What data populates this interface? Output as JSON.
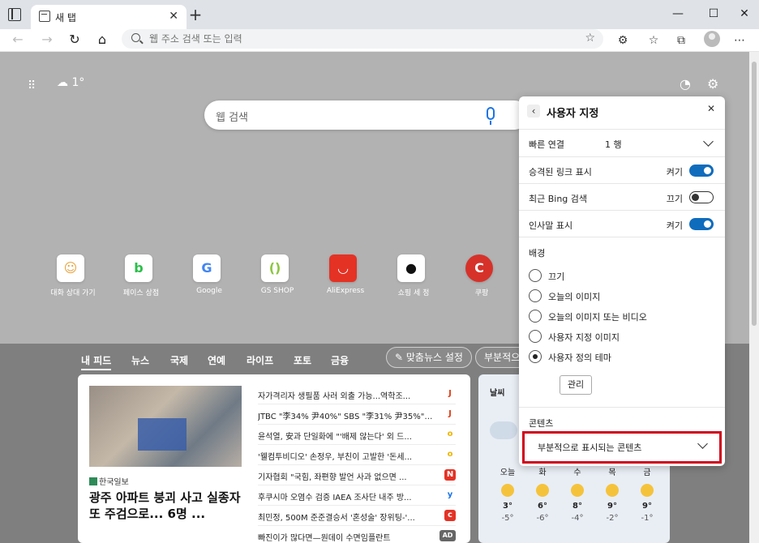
{
  "tab": {
    "title": "새 탭",
    "close": "✕"
  },
  "window": {
    "minimize": "—",
    "maximize": "☐",
    "close": "✕"
  },
  "address": {
    "placeholder": "웹 주소 검색 또는 입력"
  },
  "page": {
    "weather_top": "☁ 1°",
    "search_placeholder": "웹 검색",
    "quick_links": [
      {
        "icon": "person-icon",
        "glyph": "👤",
        "label": "대화 상대 가기",
        "color": "#e9a23b"
      },
      {
        "icon": "b-icon",
        "glyph": "b",
        "label": "페이스 상점",
        "color": "#2bbf4a"
      },
      {
        "icon": "google-icon",
        "glyph": "G",
        "label": "Google",
        "color": "#4285f4"
      },
      {
        "icon": "bracket-icon",
        "glyph": "()",
        "label": "GS SHOP",
        "color": "#8cc63f"
      },
      {
        "icon": "aliexpress-icon",
        "glyph": "◡",
        "label": "AliExpress",
        "color": "#e43225"
      },
      {
        "icon": "apple-icon",
        "glyph": "●",
        "label": "쇼핑 세 정",
        "color": "#111111"
      },
      {
        "icon": "c-icon",
        "glyph": "C",
        "label": "쿠팡",
        "color": "#d6322a"
      }
    ],
    "feed_tabs": [
      "내 피드",
      "뉴스",
      "국제",
      "연예",
      "라이프",
      "포토",
      "금융"
    ],
    "custom_news_btn": "✎ 맞춤뉴스 설정",
    "partial_btn": "부분적으"
  },
  "news": {
    "source": "한국일보",
    "headline": "광주 아파트 붕괴 사고 실종자 또 주검으로... 6명 ...",
    "items": [
      {
        "text": "자가격리자 생필품 사러 외출 가능...역학조...",
        "badge": "J",
        "color": "#e0411a"
      },
      {
        "text": "JTBC \"李34% 尹40%\" SBS \"李31% 尹35%\" ...",
        "badge": "J",
        "color": "#e0411a"
      },
      {
        "text": "윤석열, 安과 단일화에 \"'배제 않는다' 외 드...",
        "badge": "o",
        "color": "#f0b400"
      },
      {
        "text": "'웰컴투비디오' 손정우, 부친이 고발한 '돈세...",
        "badge": "o",
        "color": "#f0b400"
      },
      {
        "text": "기자협회 \"국힘, 좌편향 발언 사과 없으면 ...",
        "badge": "N",
        "color": "#e43225"
      },
      {
        "text": "후쿠시마 오염수 검증 IAEA 조사단 내주 방...",
        "badge": "y",
        "color": "#1a73e8"
      },
      {
        "text": "최민정, 500M 준준결승서 '혼성술' 장위팅-'...",
        "badge": "c",
        "color": "#e43225"
      },
      {
        "text": "빠진이가 많다면—원데이 수면임플란트",
        "badge": "AD",
        "color": "#666666"
      }
    ]
  },
  "weather": {
    "heading": "날씨",
    "days": [
      {
        "day": "오늘",
        "hi": "3°",
        "lo": "-5°"
      },
      {
        "day": "화",
        "hi": "6°",
        "lo": "-6°"
      },
      {
        "day": "수",
        "hi": "8°",
        "lo": "-4°"
      },
      {
        "day": "목",
        "hi": "9°",
        "lo": "-2°"
      },
      {
        "day": "금",
        "hi": "9°",
        "lo": "-1°"
      }
    ]
  },
  "panel": {
    "title": "사용자 지정",
    "quick_links_label": "빠른 연결",
    "quick_links_value": "1 행",
    "toggles": [
      {
        "label": "승격된 링크 표시",
        "state": "켜기",
        "on": true
      },
      {
        "label": "최근 Bing 검색",
        "state": "끄기",
        "on": false
      },
      {
        "label": "인사말 표시",
        "state": "켜기",
        "on": true
      }
    ],
    "background_label": "배경",
    "background_options": [
      "끄기",
      "오늘의 이미지",
      "오늘의 이미지 또는 비디오",
      "사용자 지정 이미지",
      "사용자 정의 테마"
    ],
    "selected_background": 4,
    "manage_label": "관리",
    "content_label": "콘텐츠",
    "content_value": "부분적으로 표시되는 콘텐츠"
  }
}
